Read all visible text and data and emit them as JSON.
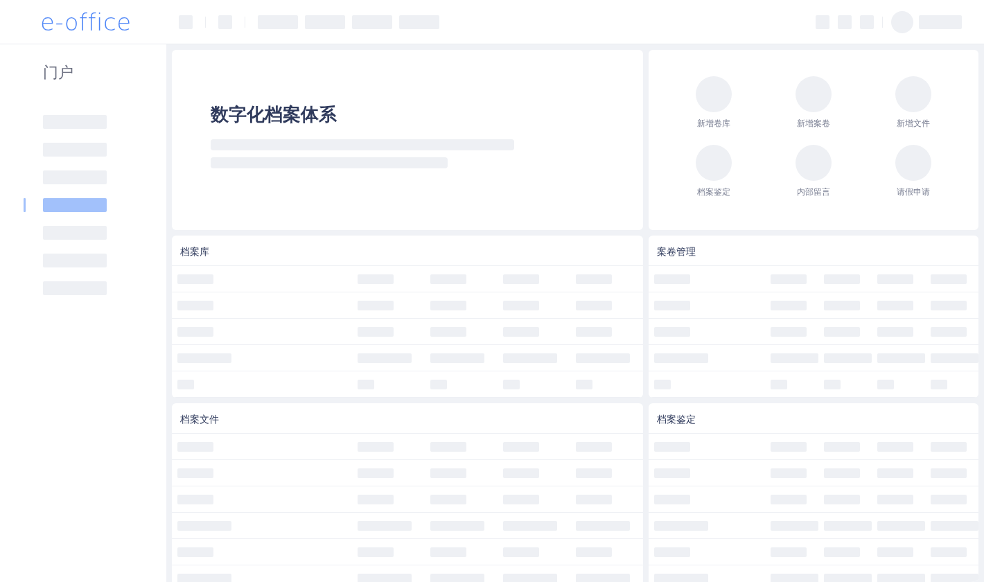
{
  "header": {
    "logo": "e-office"
  },
  "sidebar": {
    "title": "门户",
    "items": [
      {
        "selected": false
      },
      {
        "selected": false
      },
      {
        "selected": false
      },
      {
        "selected": true
      },
      {
        "selected": false
      },
      {
        "selected": false
      },
      {
        "selected": false
      }
    ]
  },
  "hero": {
    "title": "数字化档案体系"
  },
  "quick_actions": [
    {
      "label": "新增卷库"
    },
    {
      "label": "新增案卷"
    },
    {
      "label": "新增文件"
    },
    {
      "label": "档案鉴定"
    },
    {
      "label": "内部留言"
    },
    {
      "label": "请假申请"
    }
  ],
  "panels": [
    {
      "title": "档案库"
    },
    {
      "title": "案卷管理"
    },
    {
      "title": "档案文件"
    },
    {
      "title": "档案鉴定"
    }
  ]
}
